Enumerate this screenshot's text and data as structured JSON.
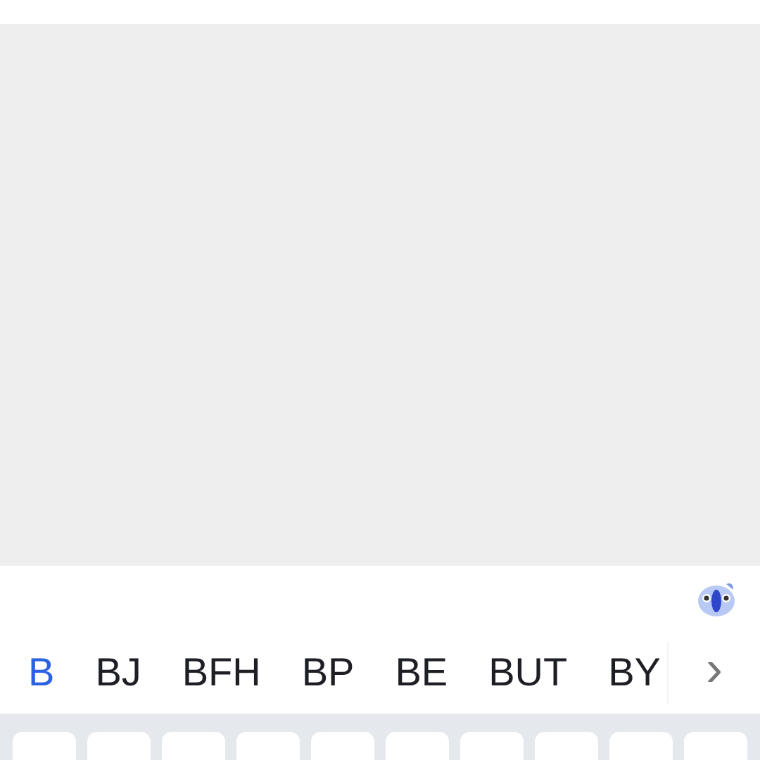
{
  "candidates": [
    {
      "text": "B",
      "selected": true
    },
    {
      "text": "BJ",
      "selected": false
    },
    {
      "text": "BFH",
      "selected": false
    },
    {
      "text": "BP",
      "selected": false
    },
    {
      "text": "BE",
      "selected": false
    },
    {
      "text": "BUT",
      "selected": false
    },
    {
      "text": "BY",
      "selected": false
    }
  ],
  "more_button": {
    "label": "›"
  }
}
